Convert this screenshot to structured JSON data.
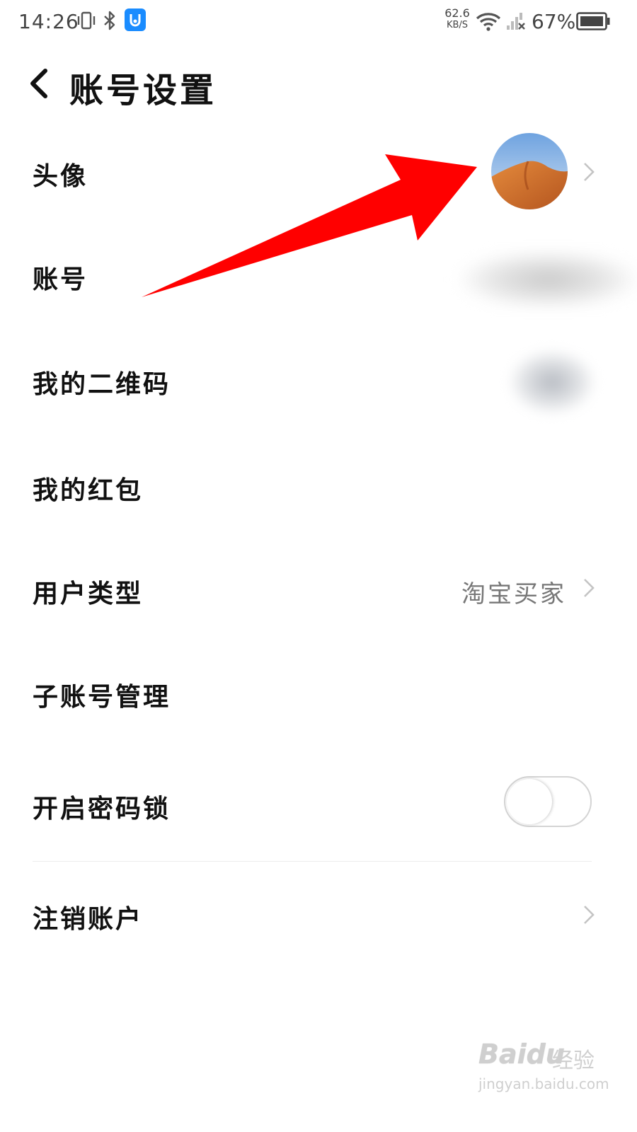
{
  "status_bar": {
    "time": "14:26",
    "speed_value": "62.6",
    "speed_unit": "KB/S",
    "battery_percent": "67%",
    "icons": [
      "vibrate-icon",
      "bluetooth-icon",
      "app-notification-icon",
      "wifi-icon",
      "signal-off-icon",
      "battery-icon"
    ]
  },
  "header": {
    "title": "账号设置",
    "back_icon": "chevron-left-icon"
  },
  "rows": {
    "avatar": {
      "label": "头像"
    },
    "account": {
      "label": "账号"
    },
    "qrcode": {
      "label": "我的二维码"
    },
    "red_packet": {
      "label": "我的红包"
    },
    "user_type": {
      "label": "用户类型",
      "value": "淘宝买家"
    },
    "sub_account": {
      "label": "子账号管理"
    },
    "password_lock": {
      "label": "开启密码锁",
      "enabled": false
    },
    "cancel_account": {
      "label": "注销账户"
    }
  },
  "annotation": {
    "arrow_color": "#ff0000"
  },
  "watermark": {
    "logo": "Baidu",
    "text": "经验",
    "url": "jingyan.baidu.com"
  }
}
